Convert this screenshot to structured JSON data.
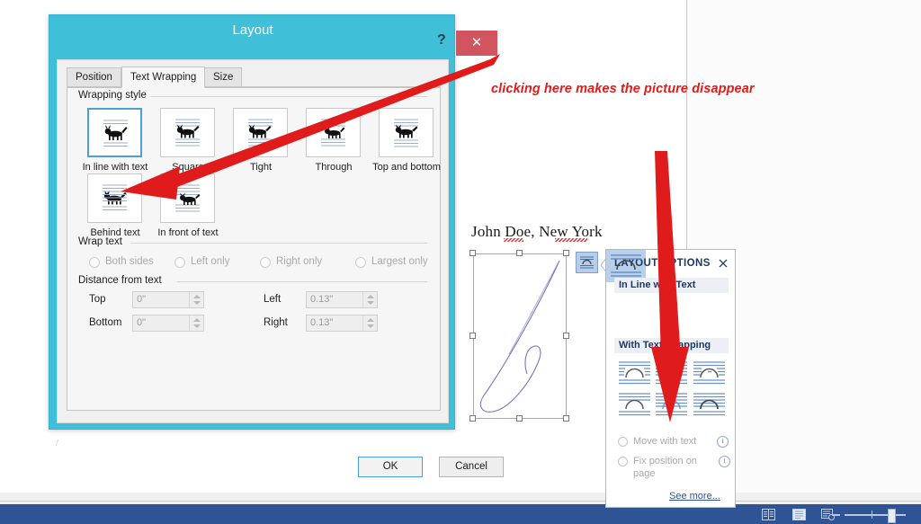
{
  "document": {
    "heading": "John Doe, New York",
    "caret_mark": "/",
    "picture_alt": "signature-image"
  },
  "status_bar": {
    "icons": [
      "read-mode-icon",
      "print-layout-icon",
      "web-layout-icon"
    ],
    "zoom_minus": "−"
  },
  "annotation": {
    "text": "clicking here makes the picture disappear",
    "color": "#e01b1b"
  },
  "layout_dialog": {
    "title": "Layout",
    "help_label": "?",
    "close_label": "✕",
    "tabs": [
      {
        "label": "Position",
        "active": false
      },
      {
        "label": "Text Wrapping",
        "active": true
      },
      {
        "label": "Size",
        "active": false
      }
    ],
    "wrapping_style": {
      "group_label": "Wrapping style",
      "options": [
        {
          "label": "In line with text",
          "selected": true,
          "icon": "wrap-inline-icon"
        },
        {
          "label": "Square",
          "selected": false,
          "icon": "wrap-square-icon"
        },
        {
          "label": "Tight",
          "selected": false,
          "icon": "wrap-tight-icon"
        },
        {
          "label": "Through",
          "selected": false,
          "icon": "wrap-through-icon"
        },
        {
          "label": "Top and bottom",
          "selected": false,
          "icon": "wrap-topbottom-icon"
        },
        {
          "label": "Behind text",
          "selected": false,
          "icon": "wrap-behind-icon"
        },
        {
          "label": "In front of text",
          "selected": false,
          "icon": "wrap-infront-icon"
        }
      ]
    },
    "wrap_text": {
      "group_label": "Wrap text",
      "options": [
        {
          "label": "Both sides",
          "selected": false
        },
        {
          "label": "Left only",
          "selected": false
        },
        {
          "label": "Right only",
          "selected": false
        },
        {
          "label": "Largest only",
          "selected": false
        }
      ]
    },
    "distance_from_text": {
      "group_label": "Distance from text",
      "fields": [
        {
          "label": "Top",
          "value": "0\""
        },
        {
          "label": "Bottom",
          "value": "0\""
        },
        {
          "label": "Left",
          "value": "0.13\""
        },
        {
          "label": "Right",
          "value": "0.13\""
        }
      ]
    },
    "buttons": {
      "ok": "OK",
      "cancel": "Cancel"
    }
  },
  "layout_options": {
    "title": "LAYOUT OPTIONS",
    "close_label": "✕",
    "section_inline": "In Line with Text",
    "section_wrapping": "With Text Wrapping",
    "inline_icon": "wrap-inline-icon",
    "wrap_icons": [
      "wrap-square-icon",
      "wrap-tight-icon",
      "wrap-through-icon",
      "wrap-topbottom-icon",
      "wrap-behind-icon",
      "wrap-infront-icon"
    ],
    "radios": [
      {
        "label": "Move with text",
        "selected": false,
        "info": "ⓘ"
      },
      {
        "label": "Fix position on page",
        "selected": false,
        "info": "ⓘ"
      }
    ],
    "see_more": "See more..."
  }
}
